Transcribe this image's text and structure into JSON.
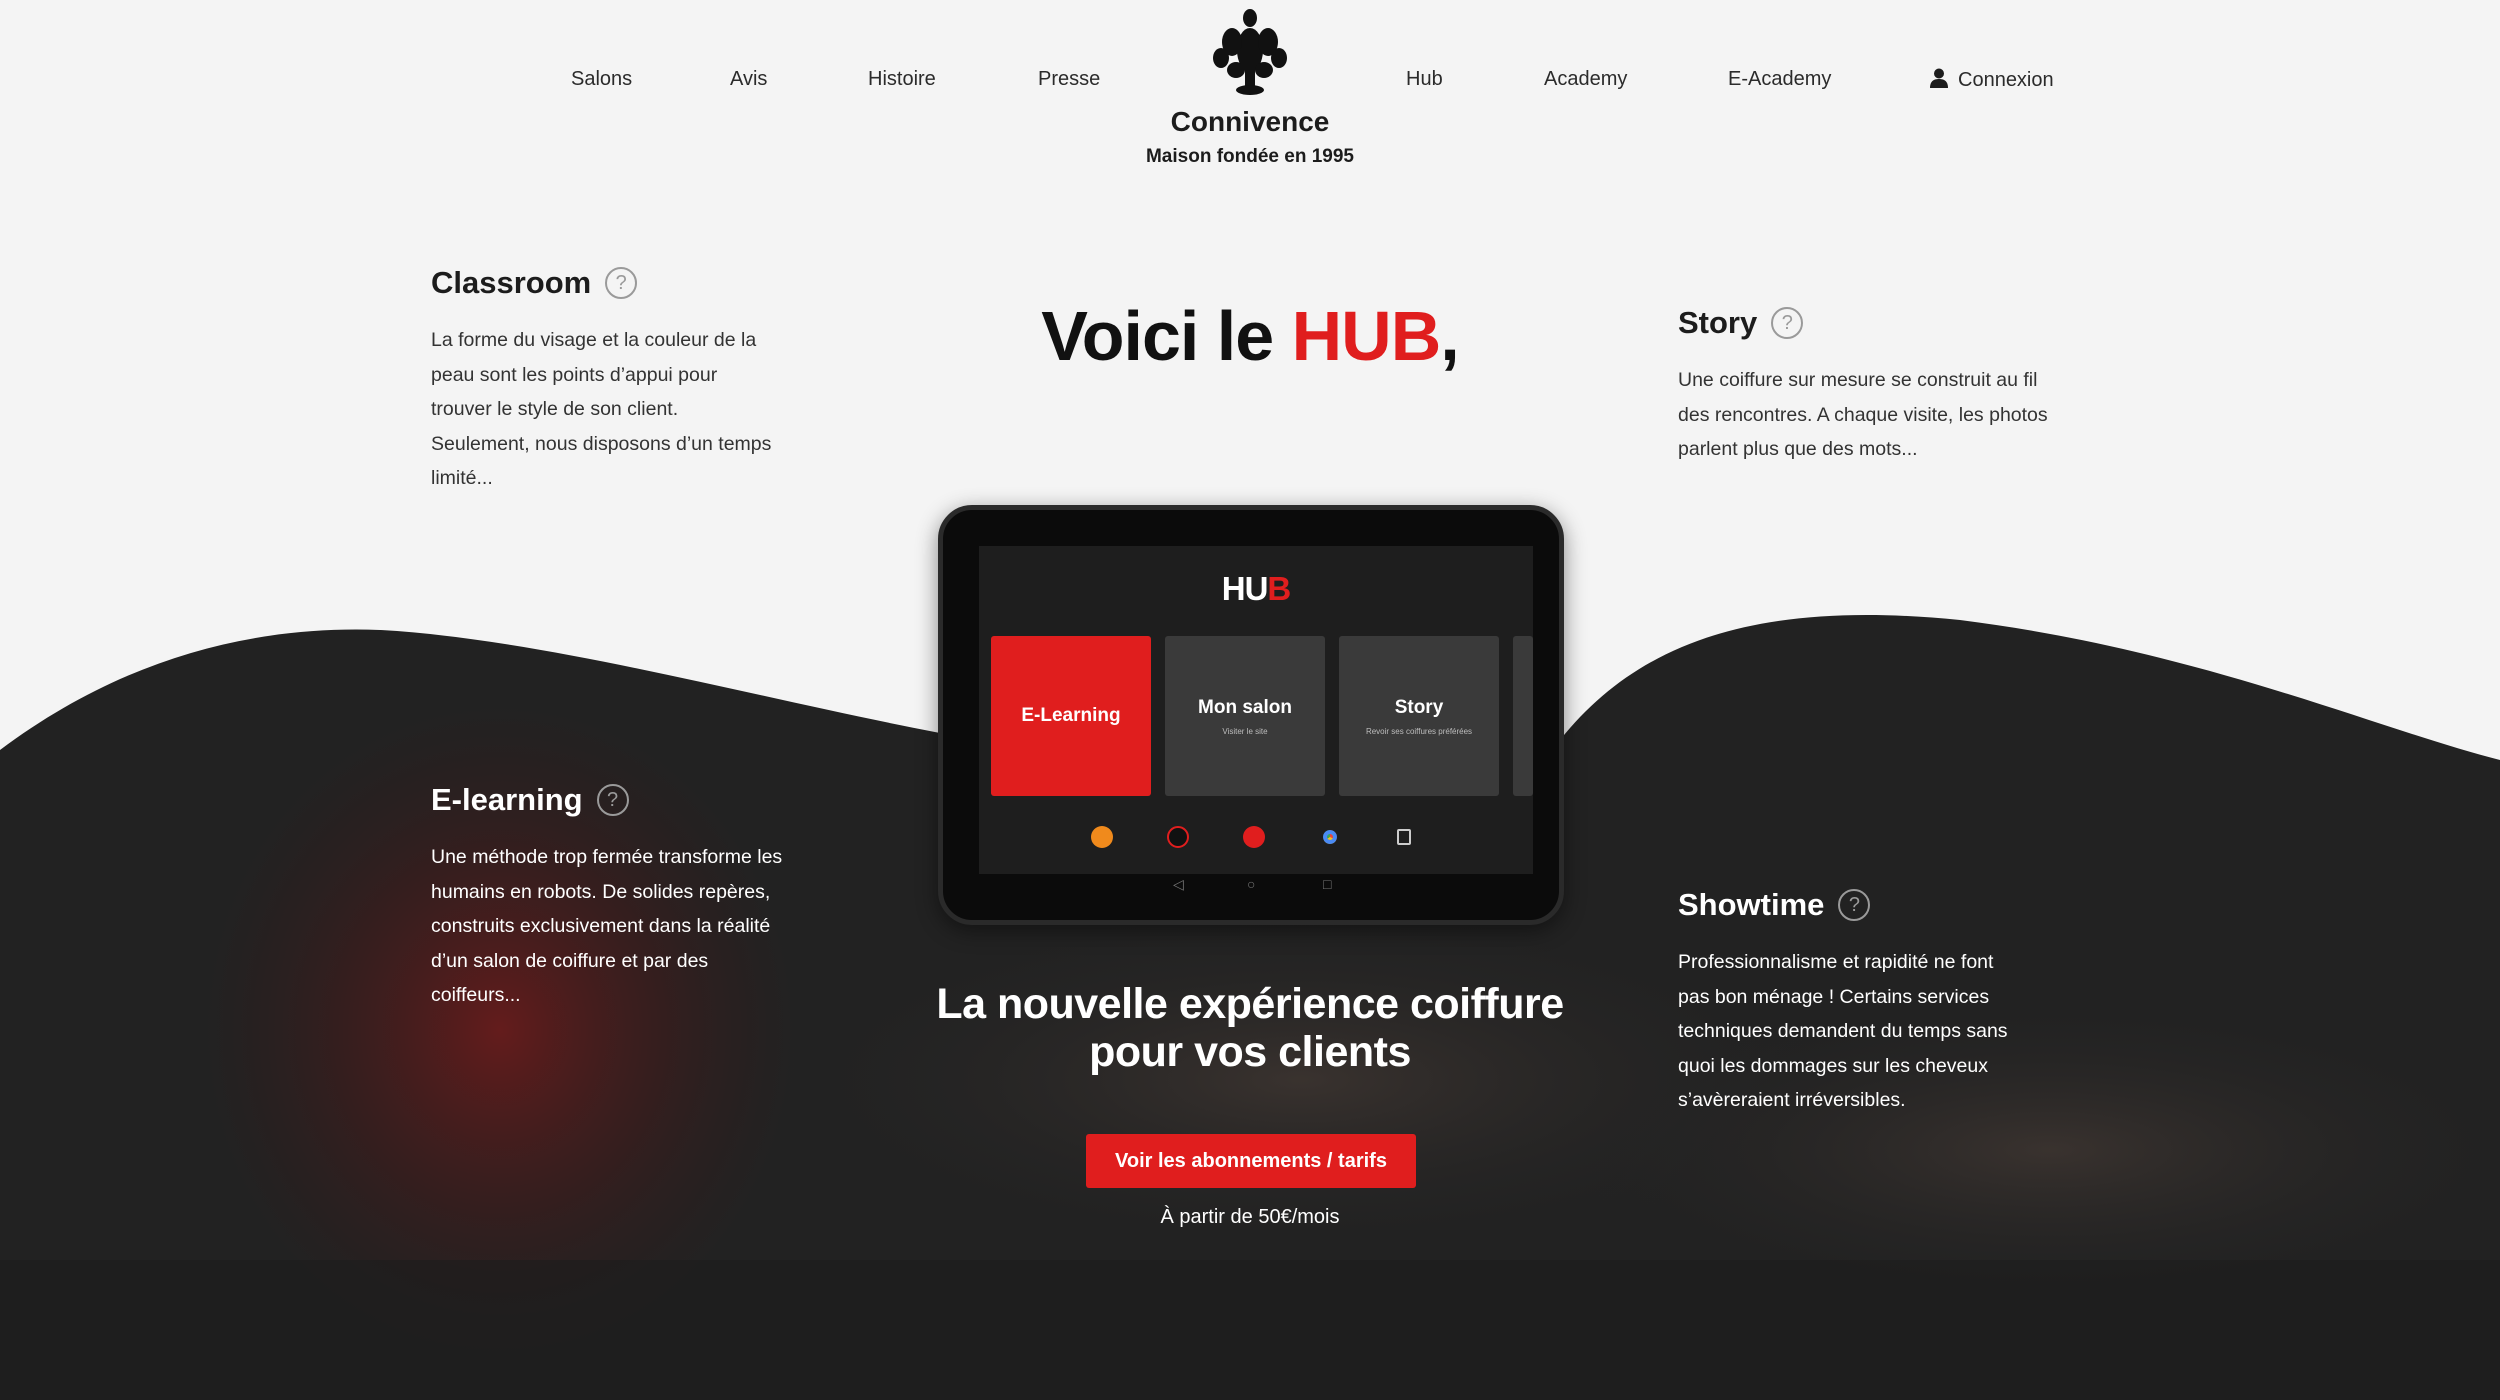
{
  "nav": {
    "left": [
      "Salons",
      "Avis",
      "Histoire",
      "Presse"
    ],
    "right": [
      "Hub",
      "Academy",
      "E-Academy"
    ],
    "login_label": "Connexion"
  },
  "brand": {
    "name": "Connivence",
    "tagline": "Maison fondée en 1995",
    "logo_icon": "ornament-icon"
  },
  "hero": {
    "title_prefix": "Voici le ",
    "title_accent": "HUB",
    "title_suffix": ","
  },
  "features": {
    "classroom": {
      "title": "Classroom",
      "text": "La forme du visage et la couleur de la peau sont les points d’appui pour trouver le style de son client. Seulement, nous disposons d’un temps limité..."
    },
    "story": {
      "title": "Story",
      "text": "Une coiffure sur mesure se construit au fil des rencontres. A chaque visite, les photos parlent plus que des mots..."
    },
    "elearning": {
      "title": "E-learning",
      "text": "Une méthode trop fermée transforme les humains en robots. De solides repères, construits exclusivement dans la réalité d’un salon de coiffure et par des coiffeurs..."
    },
    "showtime": {
      "title": "Showtime",
      "text": "Professionnalisme et rapidité ne font pas bon ménage ! Certains services techniques demandent du temps sans quoi les dommages sur les cheveux s’avèreraient irréversibles."
    },
    "help_symbol": "?"
  },
  "tablet": {
    "logo_a": "HU",
    "logo_b": "B",
    "tiles": [
      {
        "title": "E-Learning",
        "subtitle": ""
      },
      {
        "title": "Mon salon",
        "subtitle": "Visiter le site"
      },
      {
        "title": "Story",
        "subtitle": "Revoir ses coiffures préférées"
      }
    ],
    "softkeys": [
      "◁",
      "○",
      "□"
    ]
  },
  "cta": {
    "title_line1": "La nouvelle expérience coiffure",
    "title_line2": "pour vos clients",
    "button_label": "Voir les abonnements / tarifs",
    "price_text": "À partir de 50€/mois"
  },
  "colors": {
    "accent": "#e01e1e",
    "background": "#f4f4f4",
    "dark": "#1e1e1e"
  }
}
